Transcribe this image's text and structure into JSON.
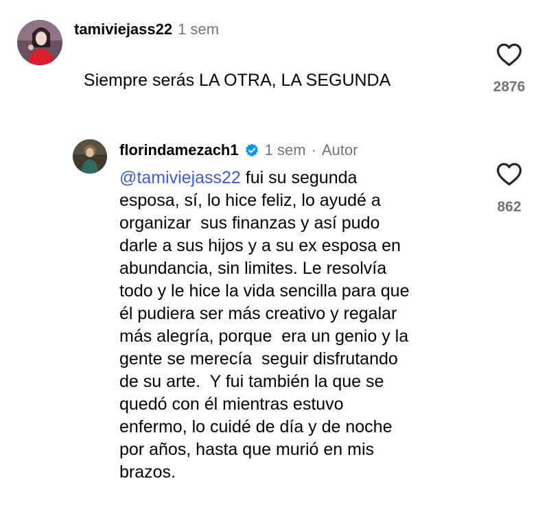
{
  "comments": [
    {
      "username": "tamiviejass22",
      "time": "1 sem",
      "text": "Siempre serás LA OTRA, LA SEGUNDA",
      "likes": "2876"
    }
  ],
  "reply": {
    "username": "florindamezach1",
    "time": "1 sem",
    "separator": "·",
    "author_label": "Autor",
    "mention": "@tamiviejass22",
    "text": " fui su segunda\nesposa, sí, lo hice feliz, lo ayudé a\norganizar  sus finanzas y así pudo\ndarle a sus hijos y a su ex esposa en\nabundancia, sin limites. Le resolvía\ntodo y le hice la vida sencilla para que\nél pudiera ser más creativo y regalar\nmás alegría, porque  era un genio y la\ngente se merecía  seguir disfrutando\nde su arte.  Y fui también la que se\nquedó con él mientras estuvo\nenfermo, lo cuidé de día y de noche\npor años, hasta que murió en mis\nbrazos.",
    "likes": "862"
  },
  "colors": {
    "mention": "#3b5bdb",
    "secondary_text": "#737373",
    "verified": "#0095f6"
  },
  "icons": {
    "like": "heart-outline-icon",
    "verified": "verified-badge-icon"
  }
}
